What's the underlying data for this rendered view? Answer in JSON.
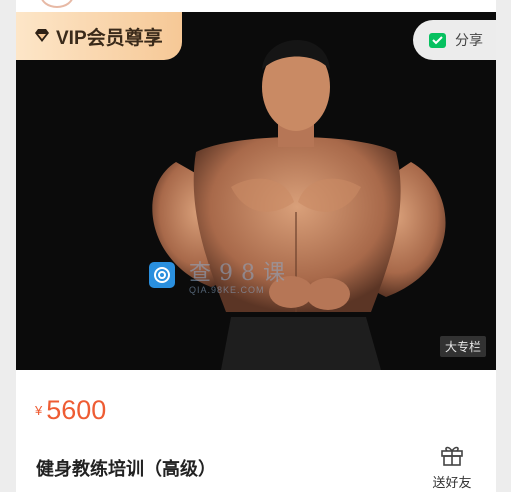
{
  "vip_badge": {
    "label": "VIP会员尊享",
    "icon": "diamond-icon"
  },
  "share": {
    "label": "分享",
    "icon": "wechat-icon"
  },
  "watermark": {
    "text": "查98课",
    "url": "QIA.98KE.COM"
  },
  "column_tag": "大专栏",
  "course": {
    "currency": "¥",
    "price": "5600",
    "title": "健身教练培训（高级）"
  },
  "gift": {
    "label": "送好友",
    "icon": "gift-icon"
  },
  "colors": {
    "price": "#ee5c33",
    "vip_start": "#fde6c8",
    "vip_end": "#f6c896",
    "wechat": "#07c160"
  }
}
